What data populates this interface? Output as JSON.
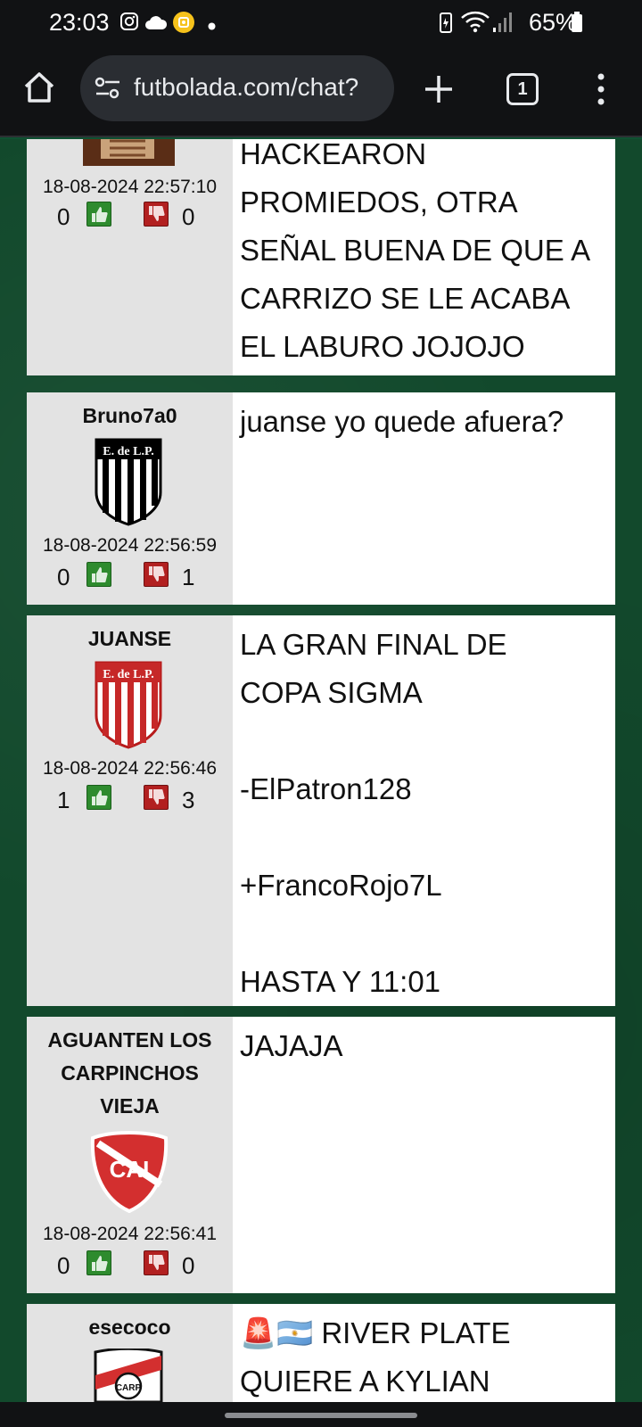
{
  "status": {
    "time": "23:03",
    "battery": "65%",
    "icons": [
      "instagram-icon",
      "cloud-icon",
      "notification-app-icon",
      "dot-icon",
      "battery-saver-icon",
      "wifi-icon",
      "signal-icon",
      "battery-icon"
    ]
  },
  "browser": {
    "url": "futbolada.com/chat?",
    "tab_count": "1"
  },
  "messages": [
    {
      "username": "",
      "avatar": "partial-image",
      "timestamp": "18-08-2024 22:57:10",
      "likes": "0",
      "dislikes": "0",
      "text": "HACKEARON\nPROMIEDOS, OTRA\nSEÑAL BUENA DE QUE A\nCARRIZO SE LE ACABA\nEL LABURO JOJOJO"
    },
    {
      "username": "Bruno7a0",
      "avatar": "estudiantes-shield-black",
      "avatar_text": "E. de L.P.",
      "timestamp": "18-08-2024 22:56:59",
      "likes": "0",
      "dislikes": "1",
      "text": "juanse yo quede afuera?"
    },
    {
      "username": "JUANSE",
      "avatar": "estudiantes-shield-red",
      "avatar_text": "E. de L.P.",
      "timestamp": "18-08-2024 22:56:46",
      "likes": "1",
      "dislikes": "3",
      "text": "LA GRAN FINAL DE\nCOPA SIGMA\n\n-ElPatron128\n\n+FrancoRojo7L\n\nHASTA Y 11:01"
    },
    {
      "username": "AGUANTEN LOS\nCARPINCHOS\nVIEJA",
      "avatar": "independiente-shield",
      "avatar_text": "CAI",
      "timestamp": "18-08-2024 22:56:41",
      "likes": "0",
      "dislikes": "0",
      "text": "JAJAJA"
    },
    {
      "username": "esecoco",
      "avatar": "river-plate-shield",
      "avatar_text": "CARP",
      "timestamp": "",
      "likes": "",
      "dislikes": "",
      "text": "🚨🇦🇷 RIVER PLATE\nQUIERE A KYLIAN"
    }
  ]
}
